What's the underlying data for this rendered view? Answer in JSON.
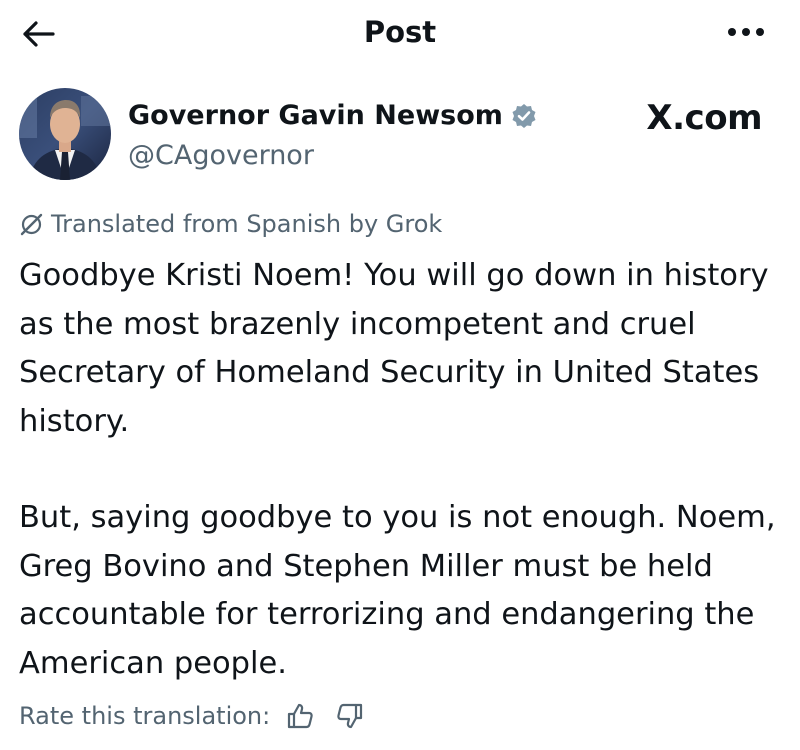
{
  "header": {
    "title": "Post",
    "back_icon": "arrow-left-icon",
    "more_icon": "more-horizontal-icon"
  },
  "author": {
    "display_name": "Governor Gavin Newsom",
    "handle": "@CAgovernor",
    "verified_icon": "verified-badge-icon",
    "verified_color": "#829aab"
  },
  "watermark": {
    "text": "X.com"
  },
  "translation": {
    "label": "Translated from Spanish by Grok",
    "icon": "grok-icon"
  },
  "post": {
    "paragraph_1": "Goodbye Kristi Noem! You will go down in history as the most brazenly incompetent and cruel Secretary of Homeland Security in United States history.",
    "paragraph_2": "But, saying goodbye to you is not enough. Noem, Greg Bovino and Stephen Miller must be held accountable for terrorizing and endangering the American people."
  },
  "rating": {
    "label": "Rate this translation:",
    "up_icon": "thumbs-up-icon",
    "down_icon": "thumbs-down-icon"
  },
  "colors": {
    "text_primary": "#0f1419",
    "text_secondary": "#536471",
    "background": "#ffffff"
  }
}
